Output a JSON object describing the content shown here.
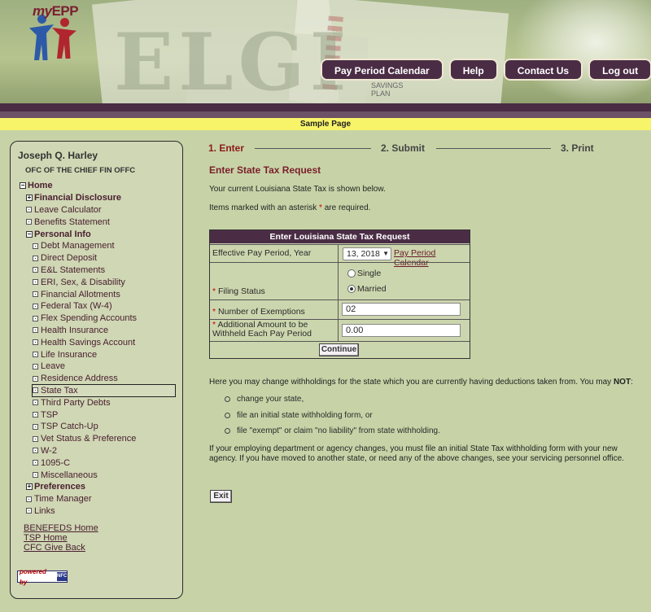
{
  "header": {
    "logo_text_my": "my",
    "logo_text_epp": "EPP",
    "savings": "SAVINGS",
    "plan": "PLAN",
    "nav": [
      {
        "label": "Pay Period Calendar"
      },
      {
        "label": "Help"
      },
      {
        "label": "Contact Us"
      },
      {
        "label": "Log out"
      }
    ]
  },
  "banner": "Sample Page",
  "sidebar": {
    "user_name": "Joseph Q. Harley",
    "org": "OFC OF THE CHIEF FIN OFFC",
    "tree": {
      "home": "Home",
      "financial_disclosure": "Financial Disclosure",
      "leave_calculator": "Leave Calculator",
      "benefits_statement": "Benefits Statement",
      "personal_info": "Personal Info",
      "debt_management": "Debt Management",
      "direct_deposit": "Direct Deposit",
      "el_statements": "E&L Statements",
      "eri": "ERI, Sex, & Disability",
      "financial_allotments": "Financial Allotments",
      "federal_tax": "Federal Tax (W-4)",
      "flex_spending": "Flex Spending Accounts",
      "health_insurance": "Health Insurance",
      "health_savings": "Health Savings Account",
      "life_insurance": "Life Insurance",
      "leave": "Leave",
      "residence_address": "Residence Address",
      "state_tax": "State Tax",
      "third_party_debts": "Third Party Debts",
      "tsp": "TSP",
      "tsp_catchup": "TSP Catch-Up",
      "vet_status": "Vet Status & Preference",
      "w2": "W-2",
      "form_1095c": "1095-C",
      "miscellaneous": "Miscellaneous",
      "preferences": "Preferences",
      "time_manager": "Time Manager",
      "links": "Links"
    },
    "links": [
      "BENEFEDS Home",
      "TSP Home",
      "CFC Give Back"
    ],
    "powered_by": "powered by",
    "powered_logo": "NFC"
  },
  "steps": {
    "step1": "1. Enter",
    "step2": "2. Submit",
    "step3": "3. Print"
  },
  "main": {
    "title": "Enter State Tax Request",
    "current": "Your current Louisiana State Tax is shown below.",
    "required_pre": "Items marked with an asterisk",
    "required_star": "*",
    "required_post": "are required.",
    "form": {
      "title": "Enter Louisiana State Tax Request",
      "effective_label": "Effective Pay Period, Year",
      "effective_value": "13, 2018",
      "pay_period_link": "Pay Period Calendar",
      "filing_label": "Filing Status",
      "filing_options": [
        "Single",
        "Married"
      ],
      "filing_selected": "Married",
      "exemptions_label": "Number of Exemptions",
      "exemptions_value": "02",
      "additional_label_1": "Additional Amount to be",
      "additional_label_2": "Withheld Each Pay Period",
      "additional_value": "0.00",
      "continue": "Continue"
    },
    "info1_pre": "Here you may change withholdings for the state which you are currently having deductions taken from. You may",
    "info1_not": "NOT",
    "info1_post": ":",
    "bullets": [
      "change your state,",
      "file an initial state withholding form, or",
      "file \"exempt\" or claim \"no liability\" from state withholding."
    ],
    "info2_line1": "If your employing department or agency changes, you must file an initial State Tax withholding form with your new",
    "info2_line2": "agency. If you have moved to another state, or need any of the above changes, see your servicing personnel office.",
    "exit": "Exit"
  },
  "colors": {
    "header_dark": "#4a2d45",
    "accent_red": "#7a1f2b",
    "banner_yellow": "#f8f46a",
    "page_bg": "#c7d3a7"
  }
}
